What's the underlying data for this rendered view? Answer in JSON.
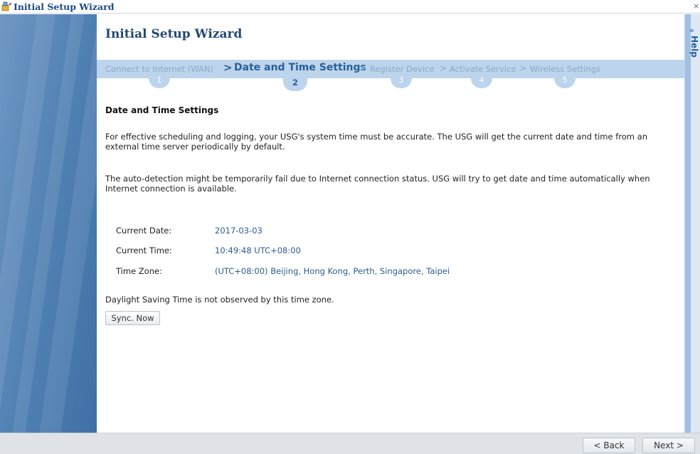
{
  "window": {
    "title": "Initial Setup Wizard",
    "close_glyph": "×"
  },
  "wizard": {
    "heading": "Initial Setup Wizard",
    "steps": [
      {
        "label": "Connect to Internet (WAN)",
        "number": "1"
      },
      {
        "label": "Date and Time Settings",
        "number": "2"
      },
      {
        "label": "Register Device",
        "number": "3"
      },
      {
        "label": "Activate Service",
        "number": "4"
      },
      {
        "label": "Wireless Settings",
        "number": "5"
      }
    ],
    "separator": ">"
  },
  "section": {
    "title": "Date and Time Settings",
    "para1": "For effective scheduling and logging, your USG's system time must be accurate. The USG will get the current date and time from an external time server periodically by default.",
    "para2": "The auto-detection might be temporarily fail due to Internet connection status. USG will try to get date and time automatically when Internet connection is available.",
    "fields": {
      "date_label": "Current Date:",
      "date_value": "2017-03-03",
      "time_label": "Current Time:",
      "time_value": "10:49:48 UTC+08:00",
      "zone_label": "Time Zone:",
      "zone_value": "(UTC+08:00) Beijing, Hong Kong, Perth, Singapore, Taipei"
    },
    "dst_note": "Daylight Saving Time is not observed by this time zone.",
    "sync_label": "Sync. Now"
  },
  "help": {
    "collapse_glyph": "«",
    "label": "Help"
  },
  "footer": {
    "back_label": "< Back",
    "next_label": "Next >"
  }
}
